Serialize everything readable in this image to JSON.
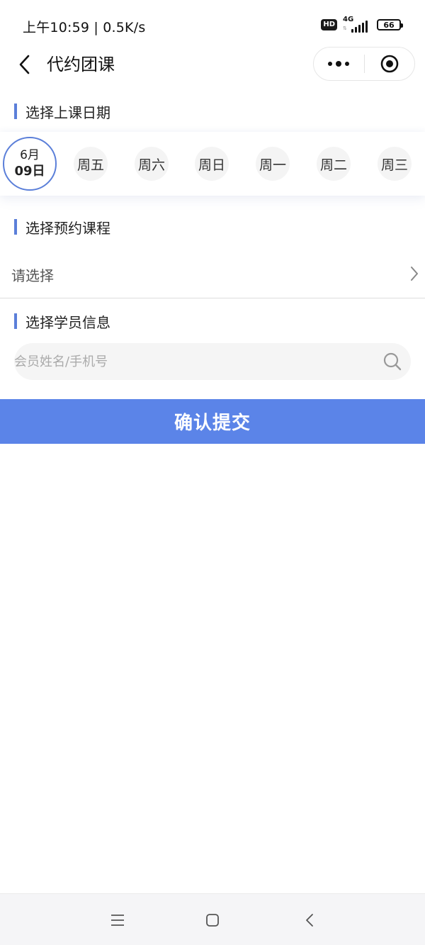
{
  "status_bar": {
    "time_speed": "上午10:59 | 0.5K/s",
    "hd": "HD",
    "network": "4G",
    "battery": "66"
  },
  "nav": {
    "title": "代约团课",
    "back_icon": "chevron-left-icon",
    "more_icon": "more-dots-icon",
    "close_icon": "target-circle-icon"
  },
  "date_section": {
    "title": "选择上课日期",
    "selected": {
      "month": "6月",
      "day": "09日"
    },
    "days": [
      "周五",
      "周六",
      "周日",
      "周一",
      "周二",
      "周三"
    ]
  },
  "course_section": {
    "title": "选择预约课程",
    "placeholder": "请选择"
  },
  "student_section": {
    "title": "选择学员信息",
    "search_placeholder": "会员姓名/手机号"
  },
  "submit": {
    "label": "确认提交"
  },
  "colors": {
    "accent": "#5b7fd9",
    "submit_bg": "#5b84e8"
  }
}
